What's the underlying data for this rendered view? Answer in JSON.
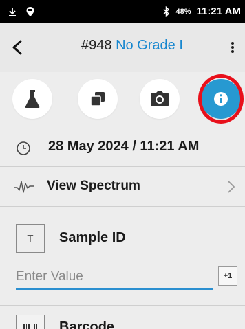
{
  "status_bar": {
    "battery": "48%",
    "time": "11:21 AM",
    "icons": [
      "download-icon",
      "location-pin-icon",
      "bluetooth-icon"
    ]
  },
  "header": {
    "sample_number": "#948",
    "grade": "No Grade I",
    "back_icon": "back-arrow-icon",
    "menu_icon": "more-vertical-icon"
  },
  "actions": {
    "items": [
      {
        "name": "flask-icon"
      },
      {
        "name": "copy-icon"
      },
      {
        "name": "camera-icon"
      },
      {
        "name": "info-icon",
        "highlighted": true
      }
    ],
    "accent_color": "#2799d1",
    "highlight_color": "#e8101b"
  },
  "datetime": {
    "value": "28 May 2024 / 11:21 AM"
  },
  "spectrum": {
    "label": "View Spectrum"
  },
  "sample_id": {
    "type_letter": "T",
    "label": "Sample ID",
    "placeholder": "Enter Value",
    "value": "",
    "increment_label": "+1"
  },
  "barcode": {
    "label": "Barcode"
  }
}
